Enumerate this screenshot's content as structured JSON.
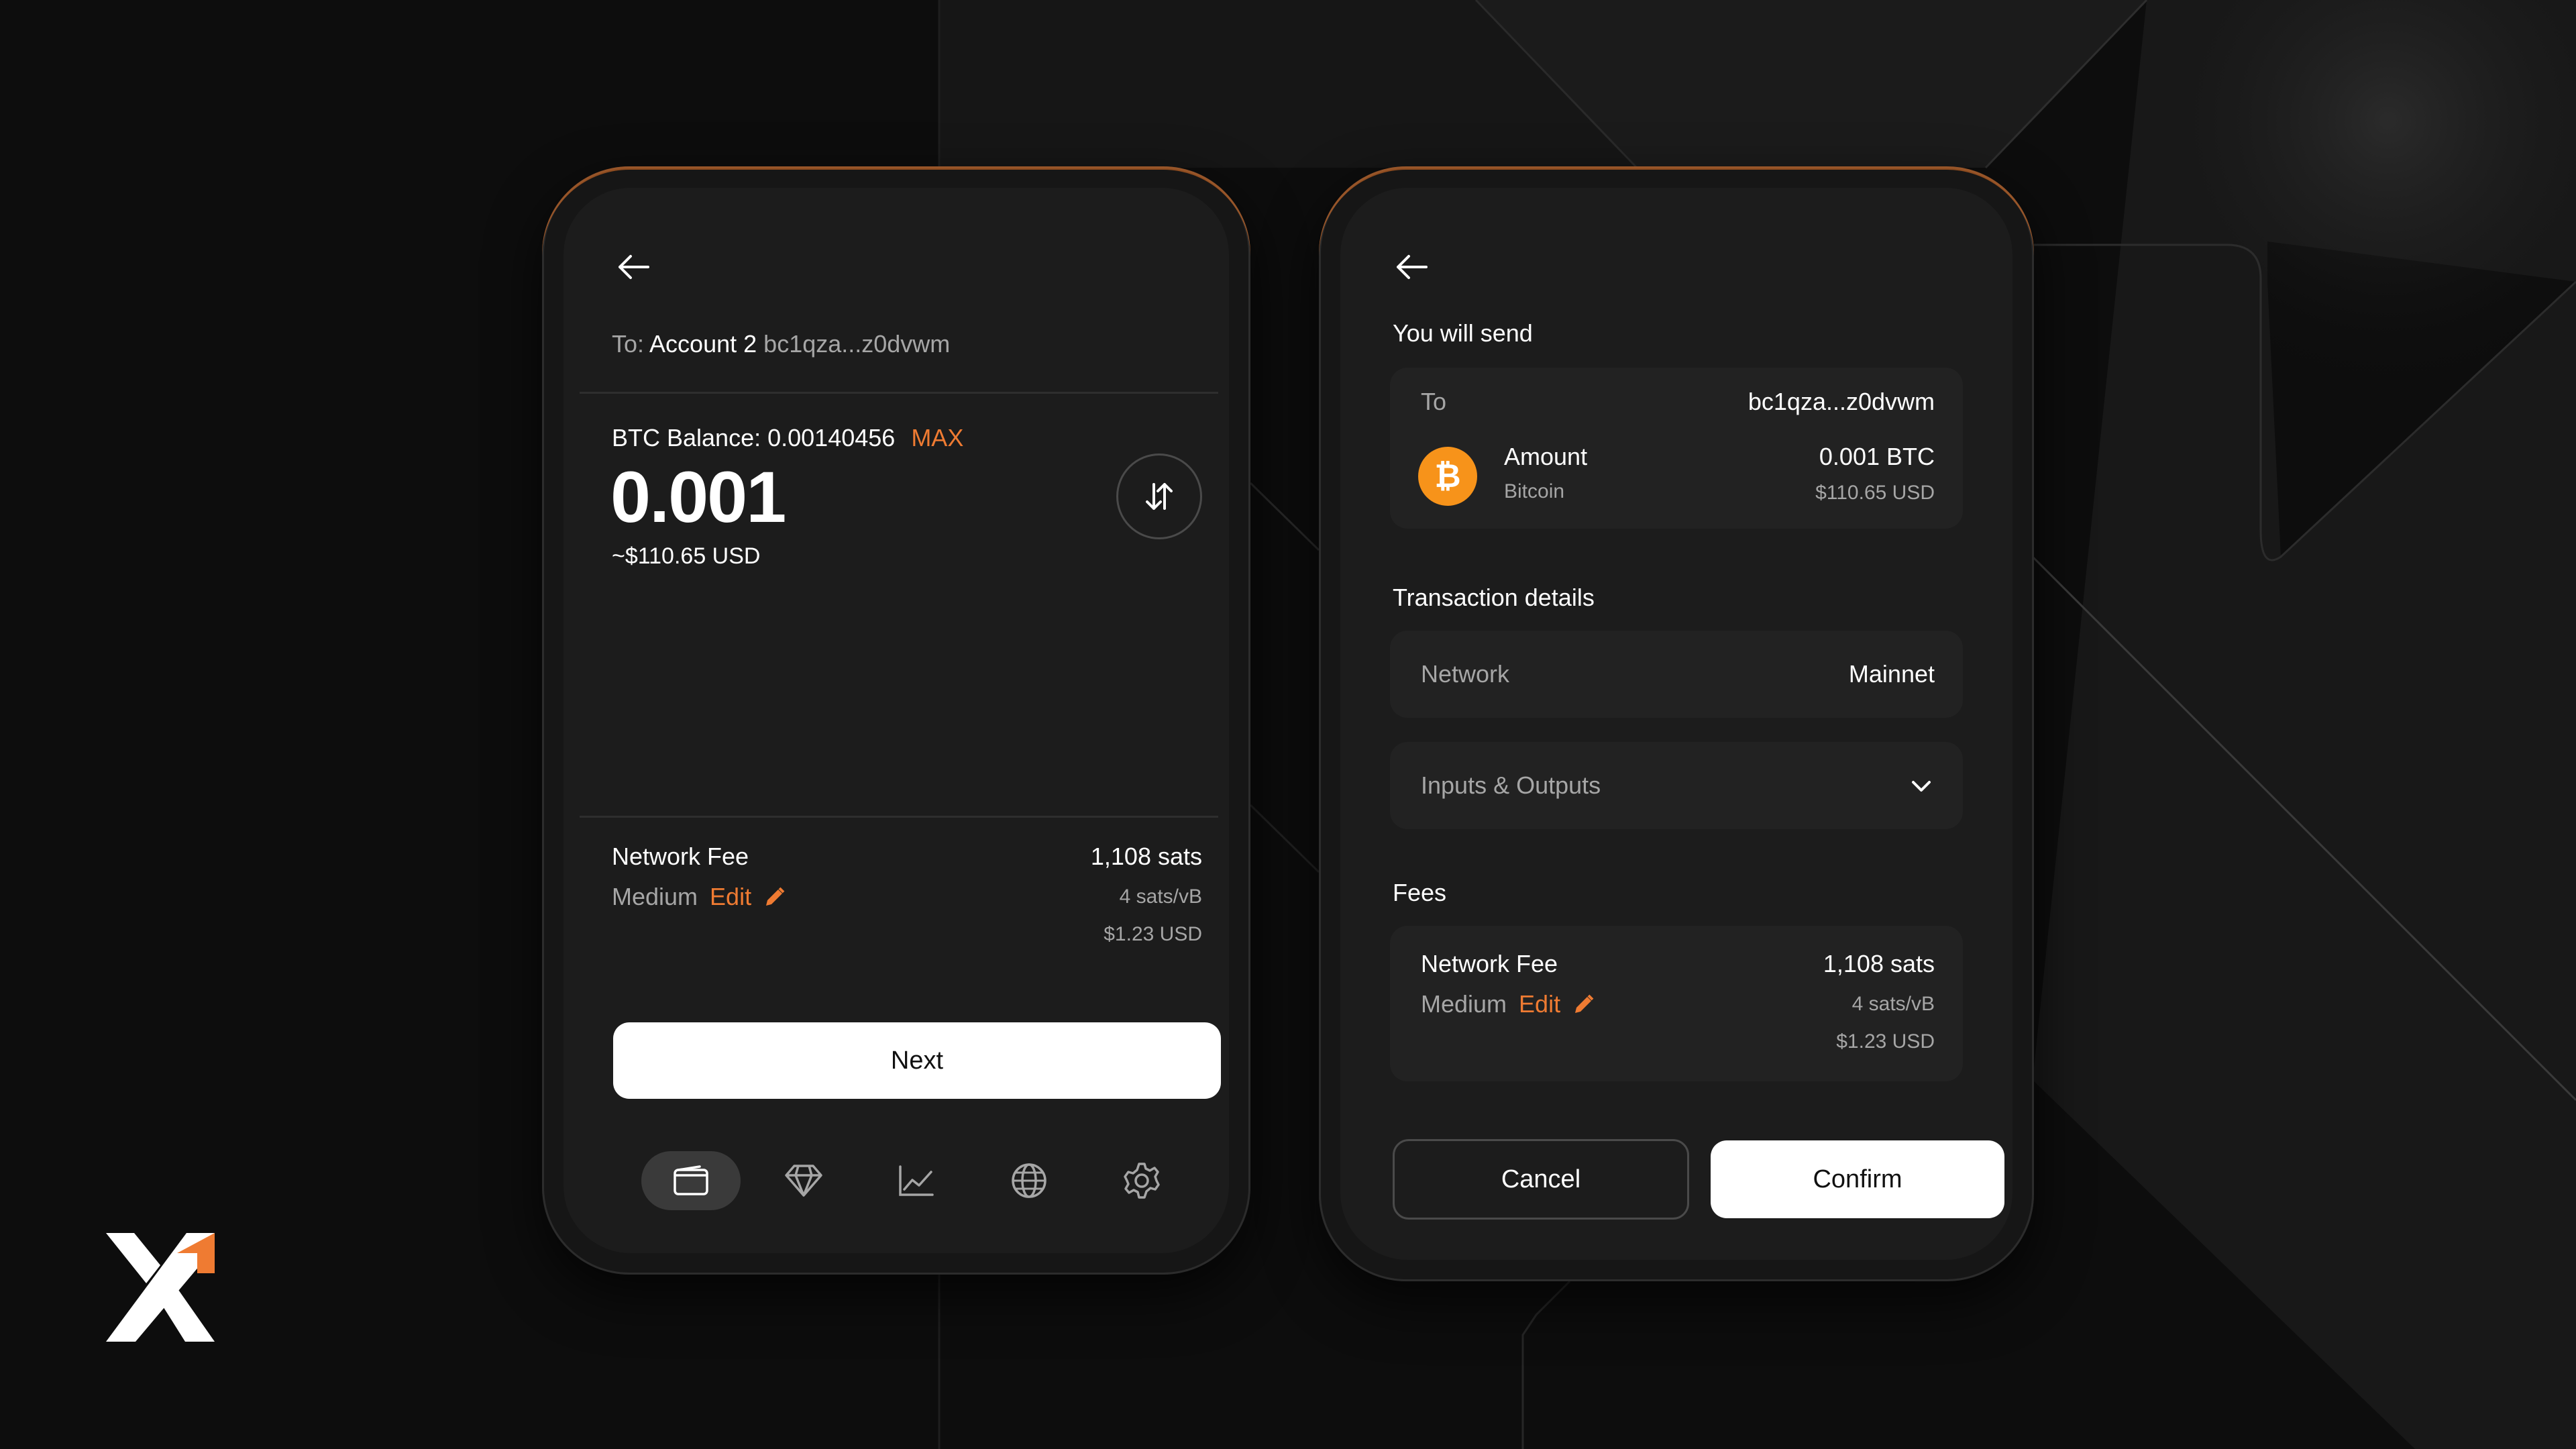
{
  "left_screen": {
    "to_prefix": "To:",
    "to_account": "Account 2",
    "to_address": "bc1qza...z0dvwm",
    "balance_label": "BTC Balance: 0.00140456",
    "max_label": "MAX",
    "amount": "0.001",
    "amount_usd": "~$110.65 USD",
    "fee_title": "Network Fee",
    "fee_speed": "Medium",
    "edit_label": "Edit",
    "fee_sats": "1,108 sats",
    "fee_rate": "4 sats/vB",
    "fee_usd": "$1.23 USD",
    "next_label": "Next",
    "nav": [
      "wallet-icon",
      "diamond-icon",
      "chart-icon",
      "globe-icon",
      "gear-icon"
    ]
  },
  "right_screen": {
    "heading": "You will send",
    "to_label": "To",
    "to_address": "bc1qza...z0dvwm",
    "amount_label": "Amount",
    "asset_name": "Bitcoin",
    "amount_btc": "0.001 BTC",
    "amount_usd": "$110.65 USD",
    "details_heading": "Transaction details",
    "network_label": "Network",
    "network_value": "Mainnet",
    "io_label": "Inputs & Outputs",
    "fees_heading": "Fees",
    "fee_title": "Network Fee",
    "fee_speed": "Medium",
    "edit_label": "Edit",
    "fee_sats": "1,108 sats",
    "fee_rate": "4 sats/vB",
    "fee_usd": "$1.23 USD",
    "cancel_label": "Cancel",
    "confirm_label": "Confirm"
  },
  "colors": {
    "accent": "#ef7b32",
    "bitcoin": "#f7931a",
    "background": "#0d0d0d",
    "card": "#222222"
  }
}
